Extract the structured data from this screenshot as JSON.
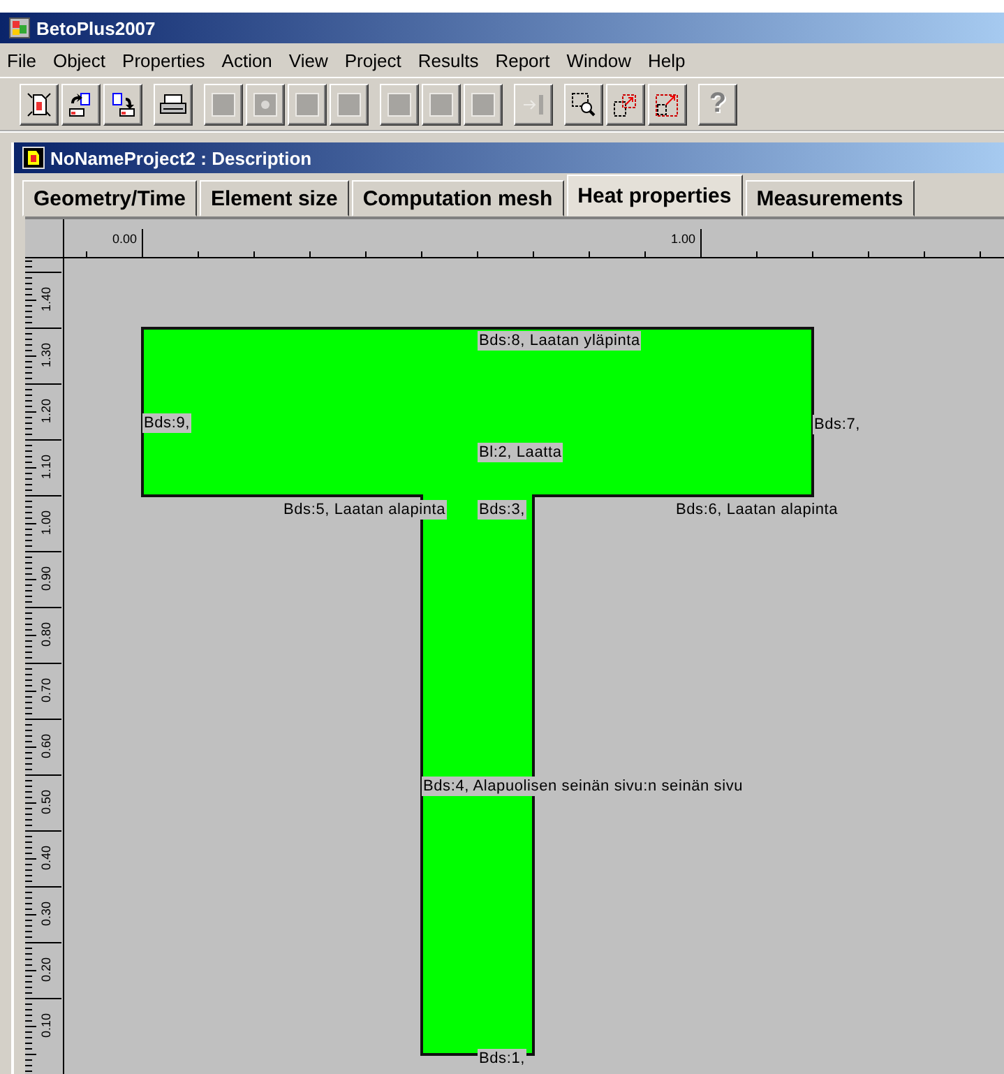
{
  "window": {
    "title": "BetoPlus2007"
  },
  "menu": [
    "File",
    "Object",
    "Properties",
    "Action",
    "View",
    "Project",
    "Results",
    "Report",
    "Window",
    "Help"
  ],
  "toolbar": [
    [
      {
        "kind": "new",
        "disabled": false
      },
      {
        "kind": "open",
        "disabled": false
      },
      {
        "kind": "save",
        "disabled": false
      }
    ],
    [
      {
        "kind": "print",
        "disabled": false
      }
    ],
    [
      {
        "kind": "square",
        "disabled": true
      },
      {
        "kind": "dot",
        "disabled": true
      },
      {
        "kind": "square",
        "disabled": true
      },
      {
        "kind": "square",
        "disabled": true
      }
    ],
    [
      {
        "kind": "square",
        "disabled": true
      },
      {
        "kind": "square",
        "disabled": true
      },
      {
        "kind": "square",
        "disabled": true
      }
    ],
    [
      {
        "kind": "arrow",
        "disabled": true
      }
    ],
    [
      {
        "kind": "zoom",
        "disabled": false
      },
      {
        "kind": "move",
        "disabled": false
      },
      {
        "kind": "resize",
        "disabled": false
      }
    ],
    [
      {
        "kind": "help",
        "label": "?",
        "disabled": true
      }
    ]
  ],
  "document": {
    "title": "NoNameProject2 : Description",
    "tabs": [
      {
        "label": "Geometry/Time",
        "selected": false
      },
      {
        "label": "Element size",
        "selected": false
      },
      {
        "label": "Computation mesh",
        "selected": false
      },
      {
        "label": "Heat properties",
        "selected": true
      },
      {
        "label": "Measurements",
        "selected": false
      }
    ],
    "ruler": {
      "x_labels": [
        "0.00",
        "1.00"
      ],
      "y_labels": [
        "1.40",
        "1.30",
        "1.20",
        "1.10",
        "1.00",
        "0.90",
        "0.80",
        "0.70",
        "0.60",
        "0.50",
        "0.40",
        "0.30",
        "0.20",
        "0.10"
      ]
    },
    "canvas": {
      "labels": [
        {
          "text": "Bds:8, Laatan yläpinta"
        },
        {
          "text": "Bds:9,"
        },
        {
          "text": "Bds:7,"
        },
        {
          "text": "Bl:2, Laatta"
        },
        {
          "text": "Bds:5, Laatan alapinta"
        },
        {
          "text": "Bds:3,"
        },
        {
          "text": "Bds:6, Laatan alapinta"
        },
        {
          "text": "Bds:4, Alapuolisen seinän sivu:n seinän sivu"
        },
        {
          "text": "Bds:1,"
        }
      ]
    }
  }
}
